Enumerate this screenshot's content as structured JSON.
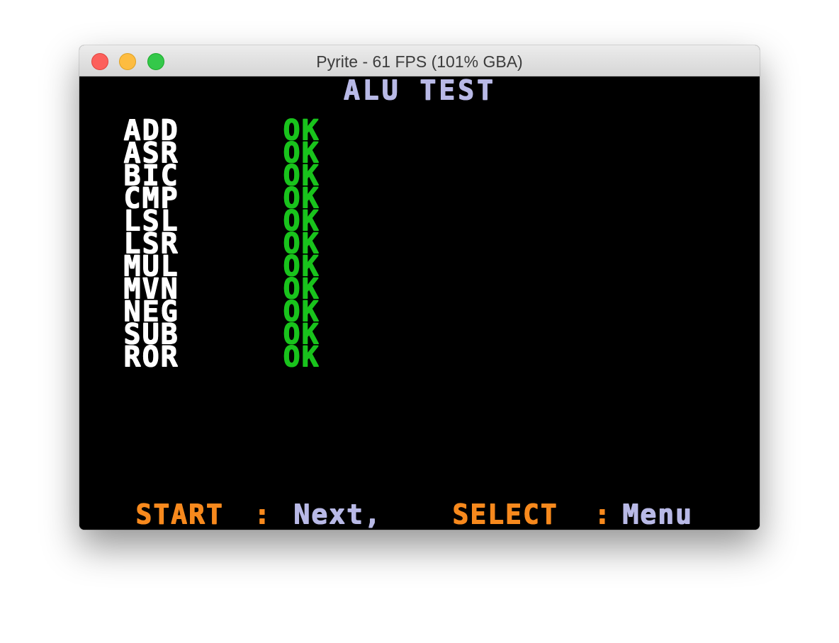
{
  "window": {
    "title": "Pyrite - 61 FPS (101% GBA)"
  },
  "screen": {
    "title": "ALU TEST",
    "rows": [
      {
        "name": "ADD",
        "status": "OK"
      },
      {
        "name": "ASR",
        "status": "OK"
      },
      {
        "name": "BIC",
        "status": "OK"
      },
      {
        "name": "CMP",
        "status": "OK"
      },
      {
        "name": "LSL",
        "status": "OK"
      },
      {
        "name": "LSR",
        "status": "OK"
      },
      {
        "name": "MUL",
        "status": "OK"
      },
      {
        "name": "MVN",
        "status": "OK"
      },
      {
        "name": "NEG",
        "status": "OK"
      },
      {
        "name": "SUB",
        "status": "OK"
      },
      {
        "name": "ROR",
        "status": "OK"
      }
    ],
    "footer": {
      "start_key": "START",
      "start_sep": ":",
      "start_action": "Next,",
      "select_key": "SELECT",
      "select_sep": ":",
      "select_action": "Menu"
    }
  },
  "colors": {
    "title": "#b8b9e6",
    "op_name": "#ffffff",
    "ok": "#19c31c",
    "key": "#f7891d",
    "background": "#000000"
  }
}
